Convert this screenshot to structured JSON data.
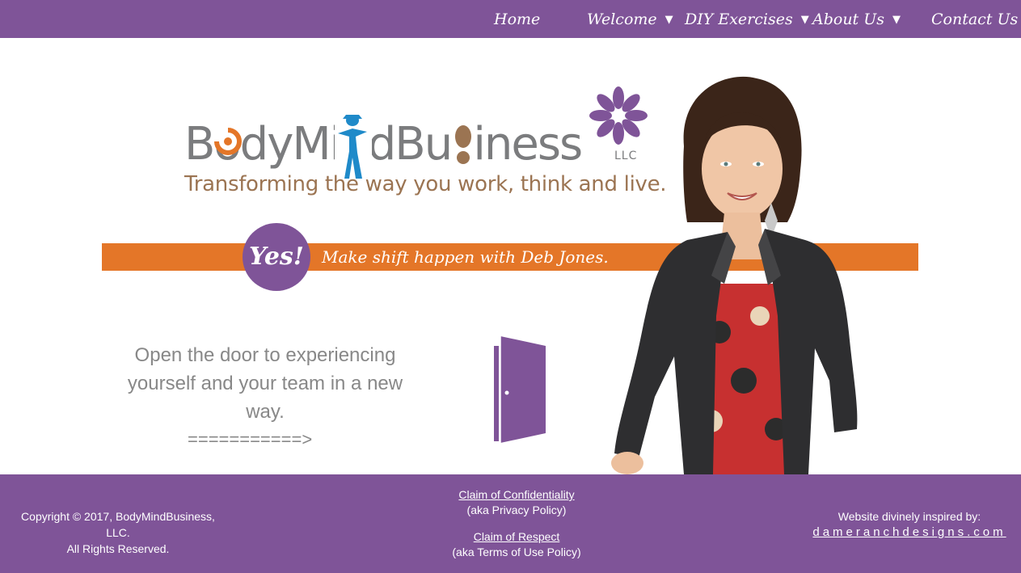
{
  "nav": {
    "items": [
      {
        "label": "Home",
        "has_dropdown": false
      },
      {
        "label": "Welcome",
        "has_dropdown": true
      },
      {
        "label": "DIY Exercises",
        "has_dropdown": true
      },
      {
        "label": "About Us",
        "has_dropdown": true
      },
      {
        "label": "Contact Us",
        "has_dropdown": false
      }
    ],
    "caret": "▼"
  },
  "hero": {
    "logo": {
      "text": "BodyMindBusiness",
      "suffix": "LLC"
    },
    "tagline": "Transforming the way you work, think and live.",
    "yes_badge": "Yes!",
    "band_text": "Make shift happen with Deb Jones.",
    "door_text": "Open the door to experiencing yourself and your team in a new way.",
    "arrow": "===========>"
  },
  "footer": {
    "copyright_line1": "Copyright © 2017, BodyMindBusiness, LLC.",
    "copyright_line2": "All Rights Reserved.",
    "privacy_link": "Claim of Confidentiality",
    "privacy_note": "(aka Privacy Policy)",
    "terms_link": "Claim of Respect",
    "terms_note": "(aka Terms of Use Policy)",
    "credit_label": "Website divinely inspired by:",
    "credit_site": "dameranchdesigns.com"
  },
  "colors": {
    "purple": "#7f5498",
    "orange": "#e47628",
    "logo_gray": "#7b7c7e",
    "tagline_brown": "#9b7452",
    "figure_blue": "#1f8ac9"
  },
  "icons": [
    "flower-icon",
    "figure-icon",
    "shoe-icon",
    "door-icon",
    "dropdown-caret-icon"
  ]
}
